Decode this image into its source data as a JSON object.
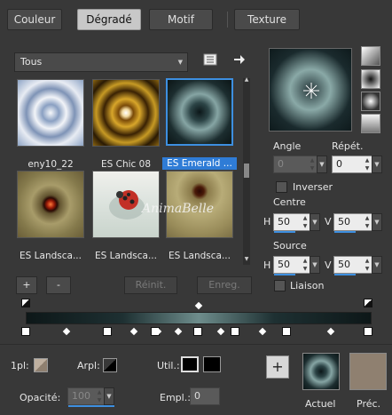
{
  "tabs": [
    "Couleur",
    "Dégradé",
    "Motif",
    "Texture"
  ],
  "category": {
    "selected": "Tous"
  },
  "gallery": [
    {
      "label": "eny10_22"
    },
    {
      "label": "ES Chic 08"
    },
    {
      "label": "ES Emerald ..."
    },
    {
      "label": "ES Landsca..."
    },
    {
      "label": "ES Landsca..."
    },
    {
      "label": "ES Landsca..."
    }
  ],
  "watermark": "AnimaBelle",
  "buttons": {
    "add": "+",
    "remove": "-",
    "reset": "Réinit.",
    "save": "Enreg."
  },
  "angle": {
    "label": "Angle",
    "value": "0"
  },
  "repeat": {
    "label": "Répét.",
    "value": "0"
  },
  "invert": {
    "label": "Inverser"
  },
  "center": {
    "label": "Centre",
    "h_label": "H",
    "h": "50",
    "v_label": "V",
    "v": "50"
  },
  "source": {
    "label": "Source",
    "h_label": "H",
    "h": "50",
    "v_label": "V",
    "v": "50"
  },
  "link": {
    "label": "Liaison"
  },
  "bottom": {
    "first_plan_label": "1pl:",
    "arpl_label": "Arpl:",
    "util_label": "Util.:",
    "opacity_label": "Opacité:",
    "opacity_value": "100",
    "empl_label": "Empl.:",
    "empl_value": "0",
    "current_label": "Actuel",
    "previous_label": "Préc."
  },
  "colors": {
    "accent": "#3d8fe0",
    "previous_swatch": "#8f8070"
  }
}
